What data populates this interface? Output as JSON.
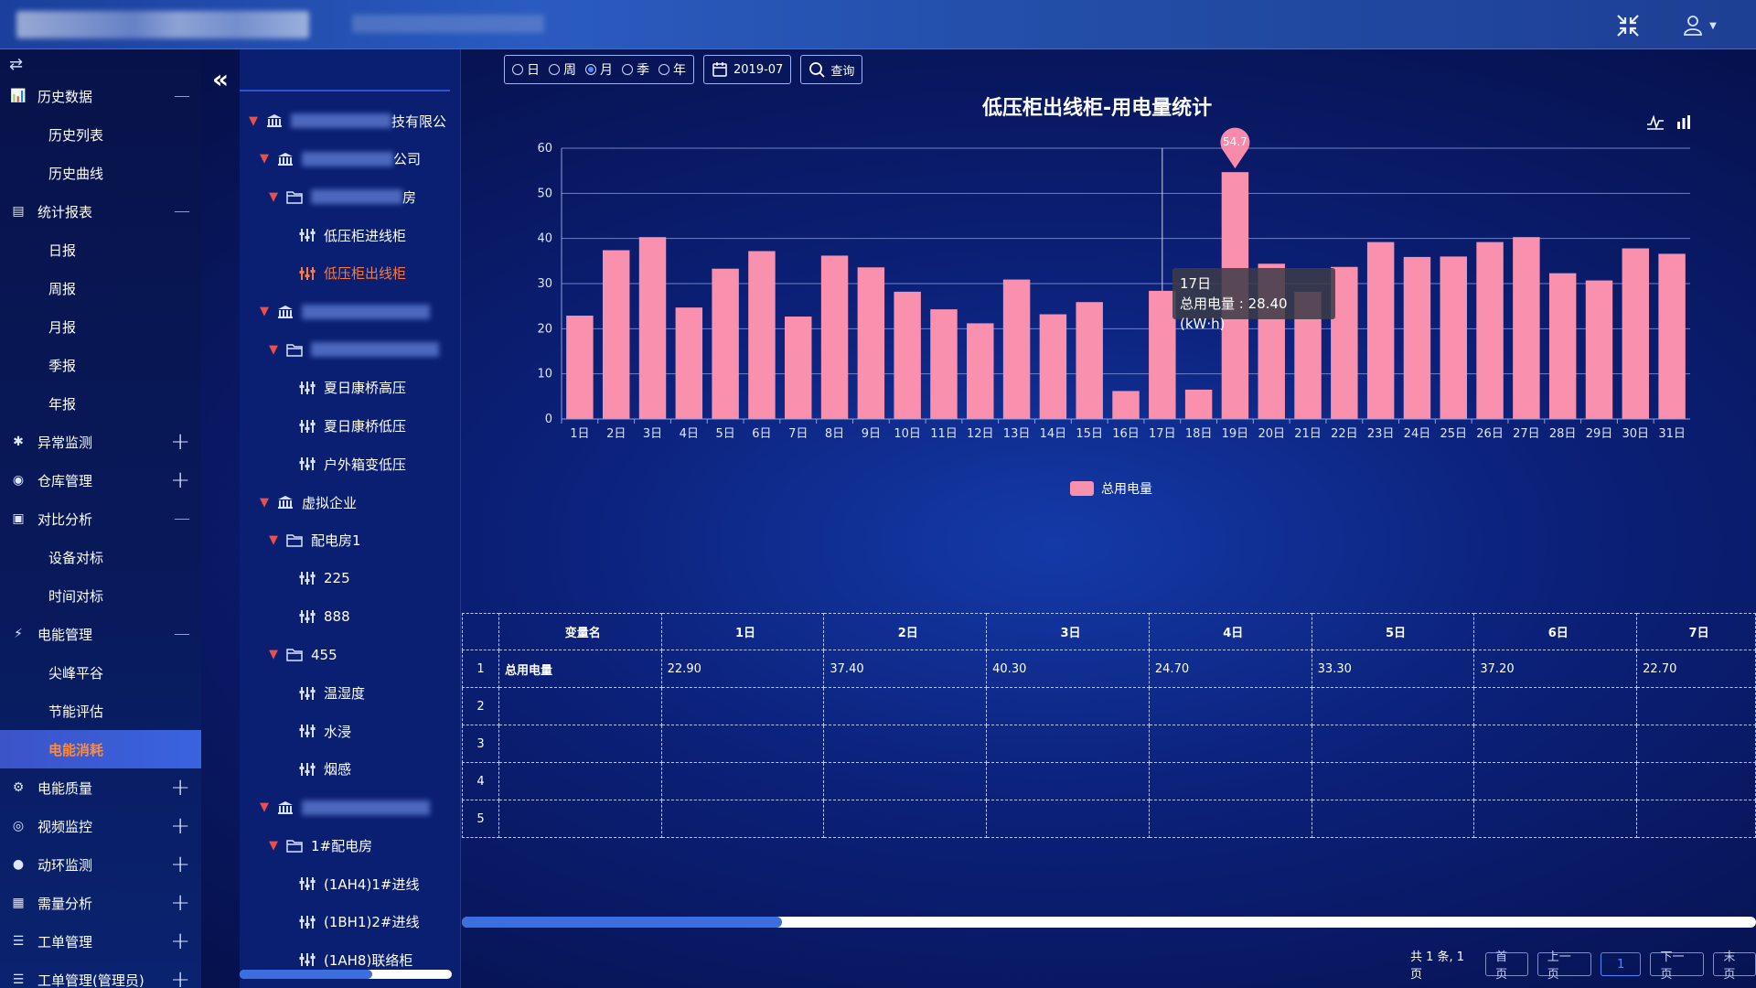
{
  "header": {
    "icons": [
      "compress-icon",
      "user-icon"
    ]
  },
  "sidebar": {
    "items": [
      {
        "label": "历史数据",
        "icon": "chart-icon",
        "expanded": true,
        "children": [
          "历史列表",
          "历史曲线"
        ]
      },
      {
        "label": "统计报表",
        "icon": "report-icon",
        "expanded": true,
        "children": [
          "日报",
          "周报",
          "月报",
          "季报",
          "年报"
        ]
      },
      {
        "label": "异常监测",
        "icon": "alert-icon",
        "expanded": false
      },
      {
        "label": "仓库管理",
        "icon": "warehouse-icon",
        "expanded": false
      },
      {
        "label": "对比分析",
        "icon": "compare-icon",
        "expanded": true,
        "children": [
          "设备对标",
          "时间对标"
        ]
      },
      {
        "label": "电能管理",
        "icon": "energy-icon",
        "expanded": true,
        "children": [
          "尖峰平谷",
          "节能评估",
          "电能消耗"
        ]
      },
      {
        "label": "电能质量",
        "icon": "quality-icon",
        "expanded": false
      },
      {
        "label": "视频监控",
        "icon": "camera-icon",
        "expanded": false
      },
      {
        "label": "动环监测",
        "icon": "monitor-icon",
        "expanded": false
      },
      {
        "label": "需量分析",
        "icon": "demand-icon",
        "expanded": false
      },
      {
        "label": "工单管理",
        "icon": "ticket-icon",
        "expanded": false
      },
      {
        "label": "工单管理(管理员)",
        "icon": "ticket-icon",
        "expanded": false
      }
    ],
    "active_sub": "电能消耗"
  },
  "tree": {
    "rows": [
      {
        "text": "技有限公",
        "level": 0,
        "type": "building"
      },
      {
        "text": "公司",
        "level": 1,
        "type": "building"
      },
      {
        "text": "房",
        "level": 2,
        "type": "folder"
      },
      {
        "text": "低压柜进线柜",
        "level": 3,
        "type": "device"
      },
      {
        "text": "低压柜出线柜",
        "level": 3,
        "type": "device",
        "selected": true
      },
      {
        "text": "",
        "level": 1,
        "type": "building"
      },
      {
        "text": "",
        "level": 2,
        "type": "folder"
      },
      {
        "text": "夏日康桥高压",
        "level": 3,
        "type": "device"
      },
      {
        "text": "夏日康桥低压",
        "level": 3,
        "type": "device"
      },
      {
        "text": "户外箱变低压",
        "level": 3,
        "type": "device"
      },
      {
        "text": "虚拟企业",
        "level": 1,
        "type": "building"
      },
      {
        "text": "配电房1",
        "level": 2,
        "type": "folder"
      },
      {
        "text": "225",
        "level": 3,
        "type": "device"
      },
      {
        "text": "888",
        "level": 3,
        "type": "device"
      },
      {
        "text": "455",
        "level": 2,
        "type": "folder"
      },
      {
        "text": "温湿度",
        "level": 3,
        "type": "device"
      },
      {
        "text": "水浸",
        "level": 3,
        "type": "device"
      },
      {
        "text": "烟感",
        "level": 3,
        "type": "device"
      },
      {
        "text": "",
        "level": 1,
        "type": "building"
      },
      {
        "text": "1#配电房",
        "level": 2,
        "type": "folder"
      },
      {
        "text": "(1AH4)1#进线",
        "level": 3,
        "type": "device"
      },
      {
        "text": "(1BH1)2#进线",
        "level": 3,
        "type": "device"
      },
      {
        "text": "(1AH8)联络柜",
        "level": 3,
        "type": "device"
      }
    ]
  },
  "toolbar": {
    "radios": [
      {
        "label": "日",
        "checked": false
      },
      {
        "label": "周",
        "checked": false
      },
      {
        "label": "月",
        "checked": true
      },
      {
        "label": "季",
        "checked": false
      },
      {
        "label": "年",
        "checked": false
      }
    ],
    "date": "2019-07",
    "query_label": "查询"
  },
  "chart_data": {
    "type": "bar",
    "title": "低压柜出线柜-用电量统计",
    "categories": [
      "1日",
      "2日",
      "3日",
      "4日",
      "5日",
      "6日",
      "7日",
      "8日",
      "9日",
      "10日",
      "11日",
      "12日",
      "13日",
      "14日",
      "15日",
      "16日",
      "17日",
      "18日",
      "19日",
      "20日",
      "21日",
      "22日",
      "23日",
      "24日",
      "25日",
      "26日",
      "27日",
      "28日",
      "29日",
      "30日",
      "31日"
    ],
    "series": [
      {
        "name": "总用电量",
        "color": "#f890ae",
        "values": [
          22.9,
          37.4,
          40.3,
          24.7,
          33.3,
          37.2,
          22.7,
          36.2,
          33.6,
          28.2,
          24.3,
          21.2,
          30.9,
          23.2,
          25.9,
          6.2,
          28.4,
          6.5,
          54.7,
          34.4,
          28.2,
          33.7,
          39.2,
          35.9,
          36.0,
          39.2,
          40.3,
          32.3,
          30.7,
          37.8,
          36.6
        ]
      }
    ],
    "ylim": [
      0,
      60
    ],
    "yticks": [
      0,
      10,
      20,
      30,
      40,
      50,
      60
    ],
    "max_label": "54.7",
    "legend": "bottom-center",
    "grid": true
  },
  "tooltip": {
    "title": "17日",
    "line": "总用电量 : 28.40 (kW·h)"
  },
  "table": {
    "headers": [
      "",
      "变量名",
      "1日",
      "2日",
      "3日",
      "4日",
      "5日",
      "6日",
      "7日"
    ],
    "rows": [
      [
        "1",
        "总用电量",
        "22.90",
        "37.40",
        "40.30",
        "24.70",
        "33.30",
        "37.20",
        "22.70"
      ],
      [
        "2",
        "",
        "",
        "",
        "",
        "",
        "",
        "",
        ""
      ],
      [
        "3",
        "",
        "",
        "",
        "",
        "",
        "",
        "",
        ""
      ],
      [
        "4",
        "",
        "",
        "",
        "",
        "",
        "",
        "",
        ""
      ],
      [
        "5",
        "",
        "",
        "",
        "",
        "",
        "",
        "",
        ""
      ]
    ]
  },
  "pager": {
    "summary": "共 1 条, 1 页",
    "first": "首页",
    "prev": "上一页",
    "current": "1",
    "next": "下一页",
    "last": "末页"
  }
}
